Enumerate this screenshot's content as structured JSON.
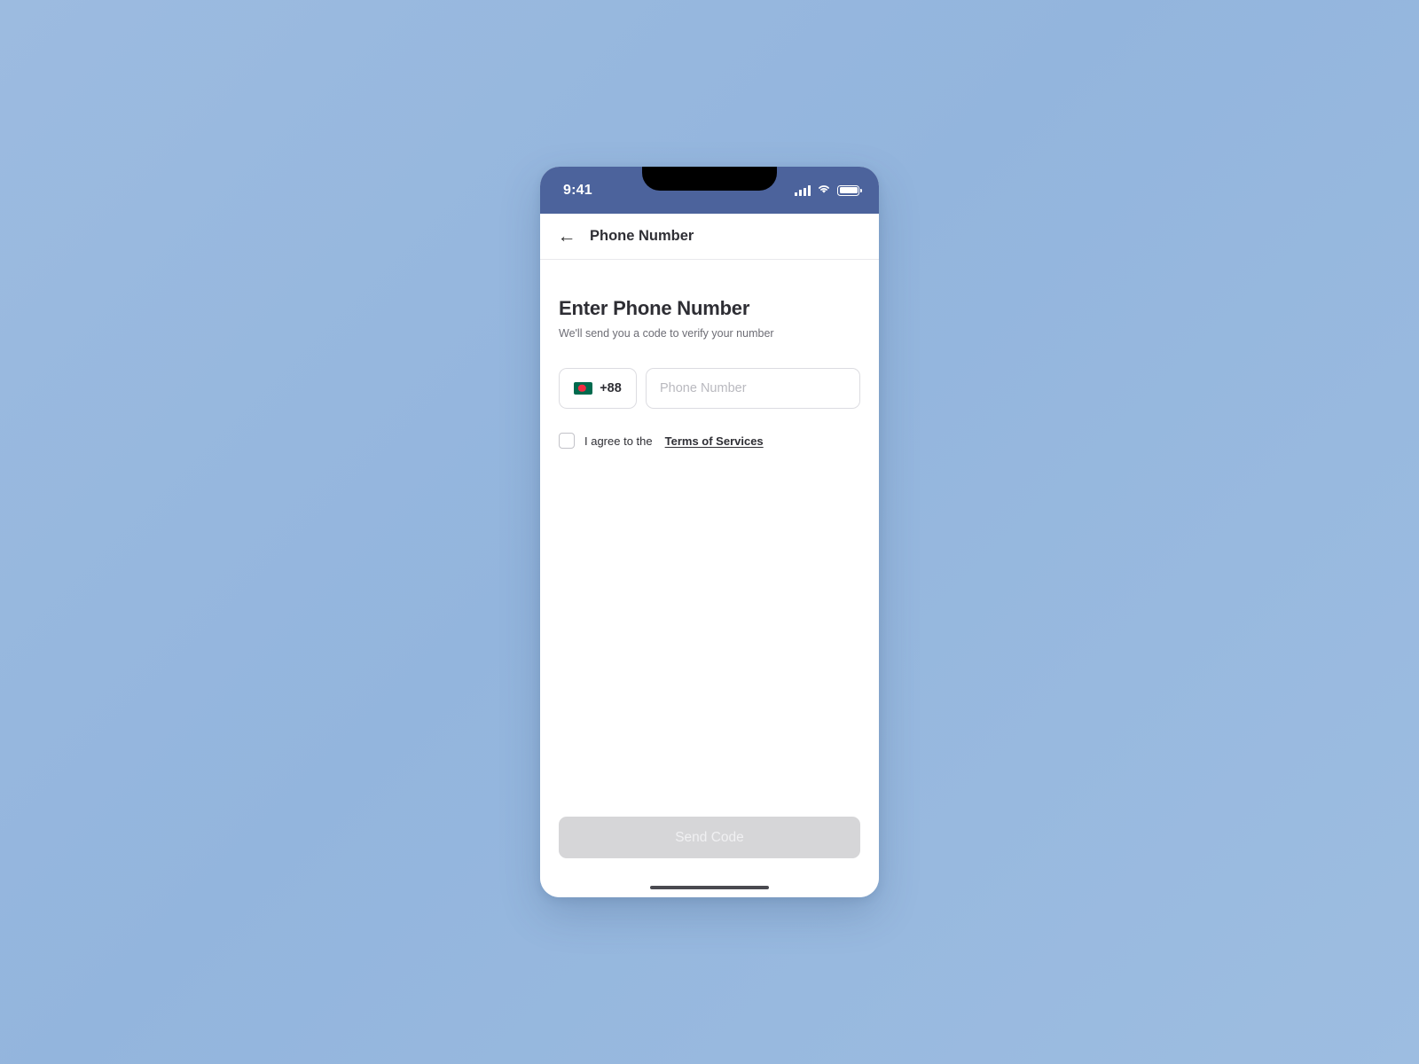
{
  "background": {
    "color_top_left": "#9cbbe0",
    "color_bottom_right": "#9dbde1"
  },
  "status_bar": {
    "time": "9:41",
    "background_color": "#4c639c",
    "icons": [
      "cellular-signal-icon",
      "wifi-icon",
      "battery-icon"
    ]
  },
  "app_bar": {
    "back_icon": "←",
    "title": "Phone Number"
  },
  "main": {
    "headline": "Enter Phone Number",
    "subhead": "We'll send you a code to verify your number",
    "country": {
      "flag": "bangladesh-flag",
      "dial_code": "+88"
    },
    "phone_field": {
      "value": "",
      "placeholder": "Phone Number"
    },
    "terms": {
      "checked": false,
      "text": "I agree to the",
      "link_label": "Terms of Services"
    }
  },
  "footer": {
    "send_label": "Send Code",
    "send_enabled": false,
    "send_background": "#d6d6d8",
    "send_text_color": "#f0f0f2"
  }
}
